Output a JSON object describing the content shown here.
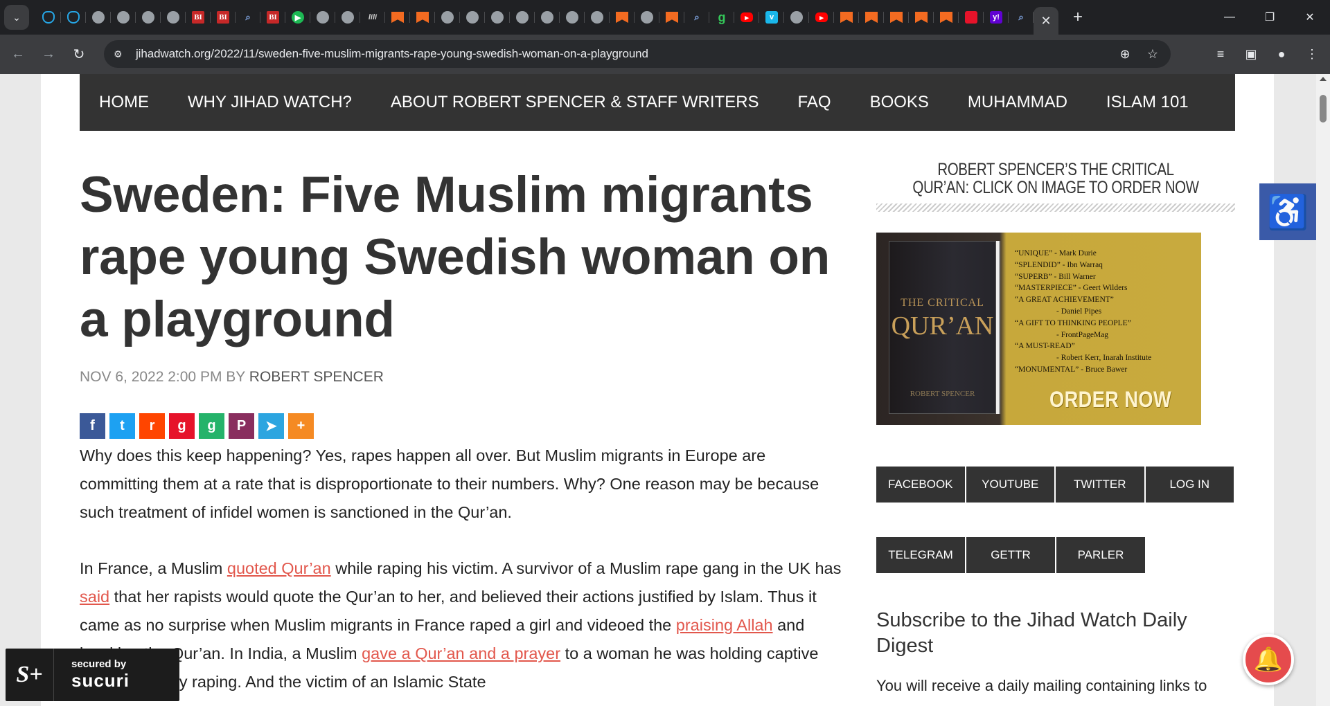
{
  "browser": {
    "url": "jihadwatch.org/2022/11/sweden-five-muslim-migrants-rape-young-swedish-woman-on-a-playground",
    "tabs": [
      {
        "icon": "shield-icon"
      },
      {
        "icon": "shield-icon"
      },
      {
        "icon": "globe-icon"
      },
      {
        "icon": "globe-icon"
      },
      {
        "icon": "globe-icon"
      },
      {
        "icon": "globe-icon"
      },
      {
        "icon": "bi-icon",
        "text": "BI"
      },
      {
        "icon": "bi-icon",
        "text": "BI"
      },
      {
        "icon": "search-icon"
      },
      {
        "icon": "bi-icon",
        "text": "BI"
      },
      {
        "icon": "play-icon"
      },
      {
        "icon": "globe-icon"
      },
      {
        "icon": "globe-icon"
      },
      {
        "icon": "slant-icon",
        "text": "lili"
      },
      {
        "icon": "bookmark-icon"
      },
      {
        "icon": "bookmark-icon"
      },
      {
        "icon": "globe-icon"
      },
      {
        "icon": "globe-icon"
      },
      {
        "icon": "globe-icon"
      },
      {
        "icon": "globe-icon"
      },
      {
        "icon": "globe-icon"
      },
      {
        "icon": "globe-icon"
      },
      {
        "icon": "globe-icon"
      },
      {
        "icon": "bookmark-icon"
      },
      {
        "icon": "globe-icon"
      },
      {
        "icon": "bookmark-icon"
      },
      {
        "icon": "search-icon"
      },
      {
        "icon": "g-icon",
        "text": "g"
      },
      {
        "icon": "youtube-icon"
      },
      {
        "icon": "vimeo-icon",
        "text": "v"
      },
      {
        "icon": "globe-icon"
      },
      {
        "icon": "youtube-icon"
      },
      {
        "icon": "bookmark-icon"
      },
      {
        "icon": "bookmark-icon"
      },
      {
        "icon": "bookmark-icon"
      },
      {
        "icon": "bookmark-icon"
      },
      {
        "icon": "bookmark-icon"
      },
      {
        "icon": "gettr-icon"
      },
      {
        "icon": "yahoo-icon",
        "text": "y!"
      },
      {
        "icon": "search-icon"
      }
    ]
  },
  "nav": {
    "items": [
      "HOME",
      "WHY JIHAD WATCH?",
      "ABOUT ROBERT SPENCER & STAFF WRITERS",
      "FAQ",
      "BOOKS",
      "MUHAMMAD",
      "ISLAM 101"
    ]
  },
  "article": {
    "title": "Sweden: Five Muslim migrants rape young Swedish woman on a playground",
    "date": "NOV 6, 2022 2:00 PM",
    "by": "BY",
    "author": "ROBERT SPENCER",
    "p1": "Why does this keep happening? Yes, rapes happen all over. But Muslim migrants in Europe are committing them at a rate that is disproportionate to their numbers. Why? One reason may be because such treatment of infidel women is sanctioned in the Qur’an.",
    "p2": {
      "t1": "In France, a Muslim ",
      "l1": "quoted Qur’an",
      "t2": " while raping his victim. A survivor of a Muslim rape gang in the UK has ",
      "l2": "said",
      "t3": " that her rapists would quote the Qur’an to her, and believed their actions justified by Islam. Thus it came as no surprise when Muslim migrants in France raped a girl and videoed the ",
      "l3": "praising Allah",
      "t4": " and invoking the Qur’an. In India, a Muslim ",
      "l4": "gave a Qur’an and a prayer",
      "t5": " to a woman he was holding captive and repeatedly raping. And the victim of an Islamic State"
    }
  },
  "sidebar": {
    "heading": "ROBERT SPENCER’S THE CRITICAL QUR’AN: CLICK ON IMAGE TO ORDER NOW",
    "ad": {
      "book_title": "THE CRITICAL",
      "book_big": "QUR’AN",
      "book_author": "ROBERT SPENCER",
      "quotes": [
        "“UNIQUE” - Mark Durie",
        "“SPLENDID” - Ibn Warraq",
        "“SUPERB” - Bill Warner",
        "“MASTERPIECE” - Geert Wilders",
        "“A GREAT ACHIEVEMENT”",
        "- Daniel Pipes",
        "“A GIFT TO THINKING PEOPLE”",
        "- FrontPageMag",
        "“A MUST-READ”",
        "- Robert Kerr, Inarah Institute",
        "“MONUMENTAL” - Bruce Bawer"
      ],
      "cta": "ORDER NOW"
    },
    "social_row1": [
      "FACEBOOK",
      "YOUTUBE",
      "TWITTER",
      "LOG IN"
    ],
    "social_row2": [
      "TELEGRAM",
      "GETTR",
      "PARLER"
    ],
    "subscribe_title": "Subscribe to the Jihad Watch Daily Digest",
    "subscribe_text": "You will receive a daily mailing containing links to"
  },
  "share_buttons": [
    {
      "name": "facebook-share",
      "color": "#3b5998",
      "glyph": "f"
    },
    {
      "name": "twitter-share",
      "color": "#1da1f2",
      "glyph": "t"
    },
    {
      "name": "reddit-share",
      "color": "#ff4500",
      "glyph": "r"
    },
    {
      "name": "gettr-share",
      "color": "#e6132a",
      "glyph": "g"
    },
    {
      "name": "gab-share",
      "color": "#25b36a",
      "glyph": "g"
    },
    {
      "name": "parler-share",
      "color": "#892e5e",
      "glyph": "P"
    },
    {
      "name": "telegram-share",
      "color": "#2ca5e0",
      "glyph": "➤"
    },
    {
      "name": "more-share",
      "color": "#f58a23",
      "glyph": "+"
    }
  ],
  "sucuri": {
    "secured_by": "secured by",
    "brand": "sucuri"
  }
}
